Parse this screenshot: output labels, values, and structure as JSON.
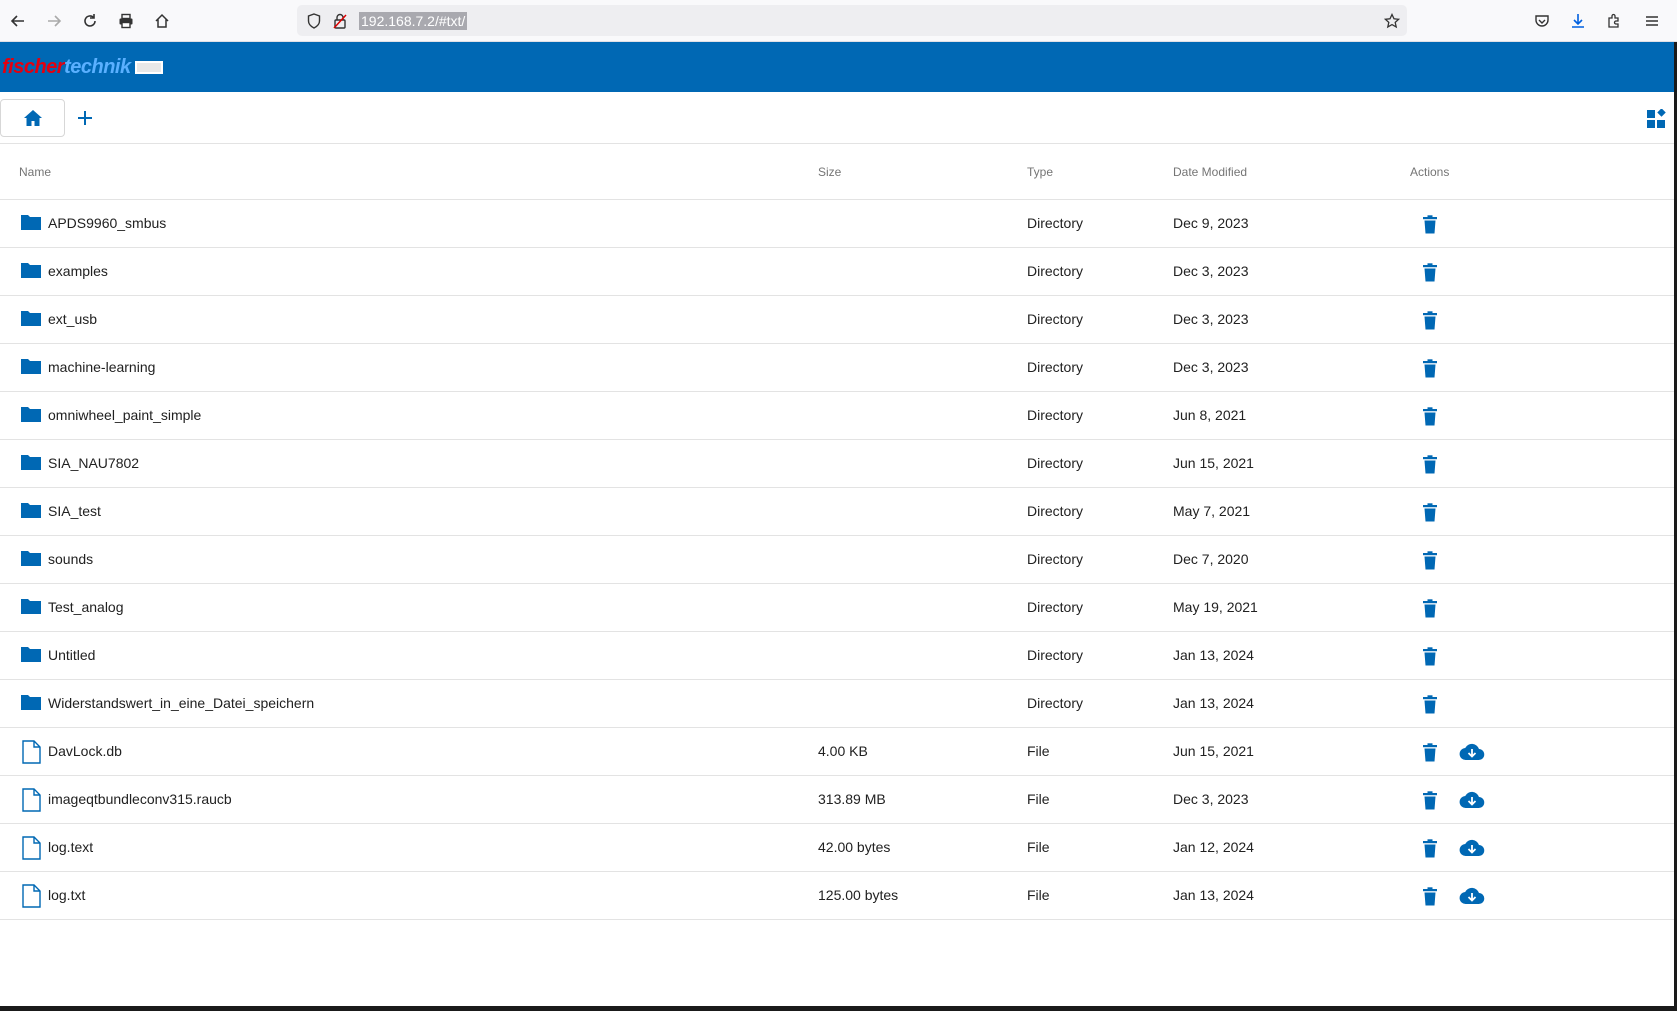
{
  "browser": {
    "url": "192.168.7.2/#txt/",
    "icons": [
      "back-arrow-icon",
      "forward-arrow-icon",
      "reload-icon",
      "print-icon",
      "home-icon",
      "shield-icon",
      "insecure-lock-icon",
      "bookmark-star-icon",
      "pocket-icon",
      "download-icon",
      "extensions-icon",
      "menu-icon"
    ]
  },
  "app": {
    "logo_part1": "fischer",
    "logo_part2": "technik",
    "accent": "#0068b4"
  },
  "table": {
    "headers": {
      "name": "Name",
      "size": "Size",
      "type": "Type",
      "date": "Date Modified",
      "actions": "Actions"
    },
    "rows": [
      {
        "name": "APDS9960_smbus",
        "size": "",
        "type": "Directory",
        "date": "Dec 9, 2023",
        "kind": "folder"
      },
      {
        "name": "examples",
        "size": "",
        "type": "Directory",
        "date": "Dec 3, 2023",
        "kind": "folder"
      },
      {
        "name": "ext_usb",
        "size": "",
        "type": "Directory",
        "date": "Dec 3, 2023",
        "kind": "folder"
      },
      {
        "name": "machine-learning",
        "size": "",
        "type": "Directory",
        "date": "Dec 3, 2023",
        "kind": "folder"
      },
      {
        "name": "omniwheel_paint_simple",
        "size": "",
        "type": "Directory",
        "date": "Jun 8, 2021",
        "kind": "folder"
      },
      {
        "name": "SIA_NAU7802",
        "size": "",
        "type": "Directory",
        "date": "Jun 15, 2021",
        "kind": "folder"
      },
      {
        "name": "SIA_test",
        "size": "",
        "type": "Directory",
        "date": "May 7, 2021",
        "kind": "folder"
      },
      {
        "name": "sounds",
        "size": "",
        "type": "Directory",
        "date": "Dec 7, 2020",
        "kind": "folder"
      },
      {
        "name": "Test_analog",
        "size": "",
        "type": "Directory",
        "date": "May 19, 2021",
        "kind": "folder"
      },
      {
        "name": "Untitled",
        "size": "",
        "type": "Directory",
        "date": "Jan 13, 2024",
        "kind": "folder"
      },
      {
        "name": "Widerstandswert_in_eine_Datei_speichern",
        "size": "",
        "type": "Directory",
        "date": "Jan 13, 2024",
        "kind": "folder"
      },
      {
        "name": "DavLock.db",
        "size": "4.00 KB",
        "type": "File",
        "date": "Jun 15, 2021",
        "kind": "file"
      },
      {
        "name": "imageqtbundleconv315.raucb",
        "size": "313.89 MB",
        "type": "File",
        "date": "Dec 3, 2023",
        "kind": "file"
      },
      {
        "name": "log.text",
        "size": "42.00 bytes",
        "type": "File",
        "date": "Jan 12, 2024",
        "kind": "file"
      },
      {
        "name": "log.txt",
        "size": "125.00 bytes",
        "type": "File",
        "date": "Jan 13, 2024",
        "kind": "file"
      }
    ]
  }
}
